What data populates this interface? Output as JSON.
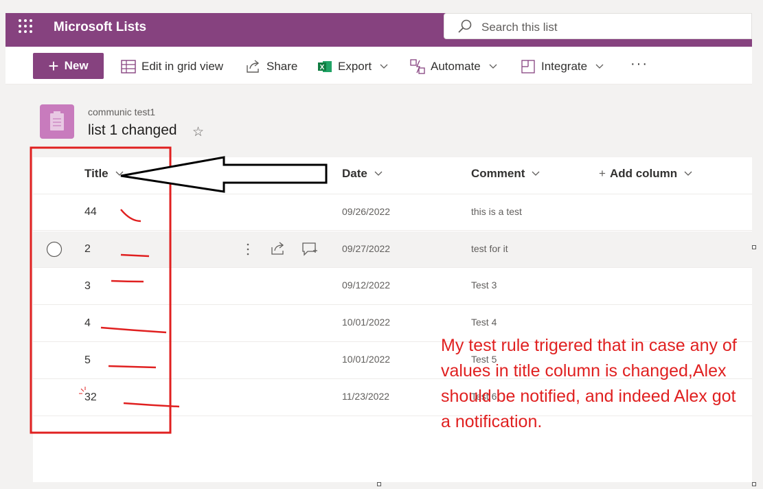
{
  "header": {
    "app_title": "Microsoft Lists",
    "search_placeholder": "Search this list"
  },
  "commandbar": {
    "new_label": "New",
    "edit_grid_label": "Edit in grid view",
    "share_label": "Share",
    "export_label": "Export",
    "automate_label": "Automate",
    "integrate_label": "Integrate",
    "more_label": "···"
  },
  "list": {
    "site_name": "communic test1",
    "list_name": "list 1 changed",
    "favorite_icon": "☆"
  },
  "columns": {
    "title": "Title",
    "date": "Date",
    "comment": "Comment",
    "add_column": "Add column"
  },
  "rows": [
    {
      "title": "44",
      "date": "09/26/2022",
      "comment": "this is a test"
    },
    {
      "title": "2",
      "date": "09/27/2022",
      "comment": "test for it"
    },
    {
      "title": "3",
      "date": "09/12/2022",
      "comment": "Test 3"
    },
    {
      "title": "4",
      "date": "10/01/2022",
      "comment": "Test 4"
    },
    {
      "title": "5",
      "date": "10/01/2022",
      "comment": "Test 5"
    },
    {
      "title": "32",
      "date": "11/23/2022",
      "comment": "Test 6"
    }
  ],
  "annotation": {
    "text": "My test rule trigered that in case any of values in title column is changed,Alex should be notified, and indeed Alex got a notification."
  },
  "colors": {
    "brand": "#86427f",
    "annotation_red": "#e02020"
  }
}
